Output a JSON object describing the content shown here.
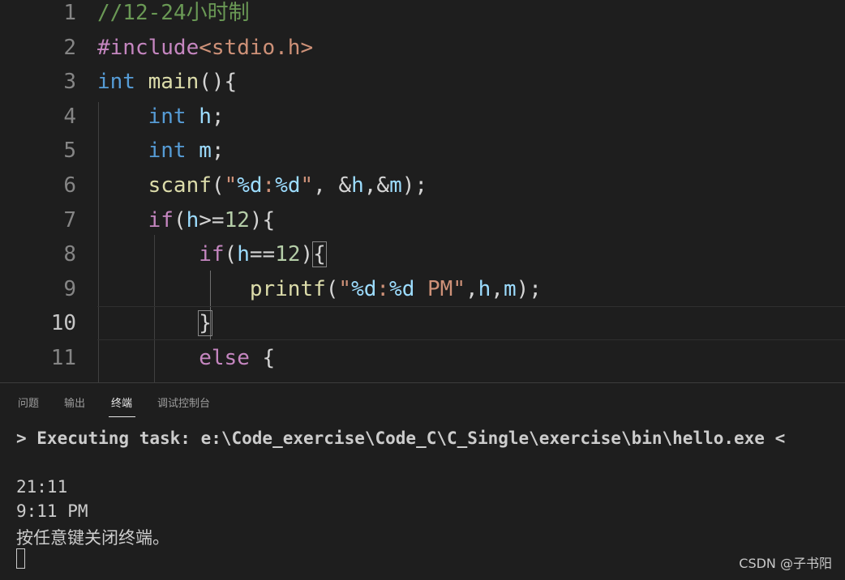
{
  "editor": {
    "active_line": 10,
    "lines": [
      {
        "n": "1",
        "tokens": [
          {
            "t": "//12-24小时制",
            "c": "comment"
          }
        ]
      },
      {
        "n": "2",
        "tokens": [
          {
            "t": "#include",
            "c": "pre"
          },
          {
            "t": "<stdio.h>",
            "c": "inc"
          }
        ]
      },
      {
        "n": "3",
        "tokens": [
          {
            "t": "int",
            "c": "kw"
          },
          {
            "t": " ",
            "c": "p"
          },
          {
            "t": "main",
            "c": "fn"
          },
          {
            "t": "(){",
            "c": "p"
          }
        ]
      },
      {
        "n": "4",
        "tokens": [
          {
            "t": "    ",
            "c": "p"
          },
          {
            "t": "int",
            "c": "kw"
          },
          {
            "t": " ",
            "c": "p"
          },
          {
            "t": "h",
            "c": "var"
          },
          {
            "t": ";",
            "c": "p"
          }
        ]
      },
      {
        "n": "5",
        "tokens": [
          {
            "t": "    ",
            "c": "p"
          },
          {
            "t": "int",
            "c": "kw"
          },
          {
            "t": " ",
            "c": "p"
          },
          {
            "t": "m",
            "c": "var"
          },
          {
            "t": ";",
            "c": "p"
          }
        ]
      },
      {
        "n": "6",
        "tokens": [
          {
            "t": "    ",
            "c": "p"
          },
          {
            "t": "scanf",
            "c": "fn"
          },
          {
            "t": "(",
            "c": "p"
          },
          {
            "t": "\"",
            "c": "str"
          },
          {
            "t": "%d",
            "c": "esc"
          },
          {
            "t": ":",
            "c": "str"
          },
          {
            "t": "%d",
            "c": "esc"
          },
          {
            "t": "\"",
            "c": "str"
          },
          {
            "t": ", &",
            "c": "p"
          },
          {
            "t": "h",
            "c": "var"
          },
          {
            "t": ",&",
            "c": "p"
          },
          {
            "t": "m",
            "c": "var"
          },
          {
            "t": ");",
            "c": "p"
          }
        ]
      },
      {
        "n": "7",
        "tokens": [
          {
            "t": "    ",
            "c": "p"
          },
          {
            "t": "if",
            "c": "ctrl"
          },
          {
            "t": "(",
            "c": "p"
          },
          {
            "t": "h",
            "c": "var"
          },
          {
            "t": ">=",
            "c": "p"
          },
          {
            "t": "12",
            "c": "num"
          },
          {
            "t": "){",
            "c": "p"
          }
        ]
      },
      {
        "n": "8",
        "tokens": [
          {
            "t": "        ",
            "c": "p"
          },
          {
            "t": "if",
            "c": "ctrl"
          },
          {
            "t": "(",
            "c": "p"
          },
          {
            "t": "h",
            "c": "var"
          },
          {
            "t": "==",
            "c": "p"
          },
          {
            "t": "12",
            "c": "num"
          },
          {
            "t": ")",
            "c": "p"
          },
          {
            "t": "{",
            "c": "p",
            "m": true
          }
        ]
      },
      {
        "n": "9",
        "tokens": [
          {
            "t": "            ",
            "c": "p"
          },
          {
            "t": "printf",
            "c": "fn"
          },
          {
            "t": "(",
            "c": "p"
          },
          {
            "t": "\"",
            "c": "str"
          },
          {
            "t": "%d",
            "c": "esc"
          },
          {
            "t": ":",
            "c": "str"
          },
          {
            "t": "%d",
            "c": "esc"
          },
          {
            "t": " PM\"",
            "c": "str"
          },
          {
            "t": ",",
            "c": "p"
          },
          {
            "t": "h",
            "c": "var"
          },
          {
            "t": ",",
            "c": "p"
          },
          {
            "t": "m",
            "c": "var"
          },
          {
            "t": ");",
            "c": "p"
          }
        ]
      },
      {
        "n": "10",
        "tokens": [
          {
            "t": "        ",
            "c": "p"
          },
          {
            "t": "}",
            "c": "p",
            "m": true
          }
        ]
      },
      {
        "n": "11",
        "tokens": [
          {
            "t": "        ",
            "c": "p"
          },
          {
            "t": "else",
            "c": "ctrl"
          },
          {
            "t": " {",
            "c": "p"
          }
        ]
      }
    ]
  },
  "panel": {
    "tabs": [
      {
        "label": "问题",
        "active": false
      },
      {
        "label": "输出",
        "active": false
      },
      {
        "label": "终端",
        "active": true
      },
      {
        "label": "调试控制台",
        "active": false
      }
    ],
    "terminal": {
      "task_line": "> Executing task: e:\\Code_exercise\\Code_C\\C_Single\\exercise\\bin\\hello.exe <",
      "input_line": "21:11",
      "output_line": "9:11 PM",
      "close_prompt": "按任意键关闭终端。"
    }
  },
  "watermark": "CSDN @子书阳",
  "colors": {
    "background": "#1e1e1e",
    "comment": "#6a9955",
    "keyword": "#569cd6",
    "function": "#dcdcaa",
    "variable": "#9cdcfe",
    "string": "#ce9178",
    "number": "#b5cea8",
    "control": "#c586c0",
    "text": "#d4d4d4"
  }
}
